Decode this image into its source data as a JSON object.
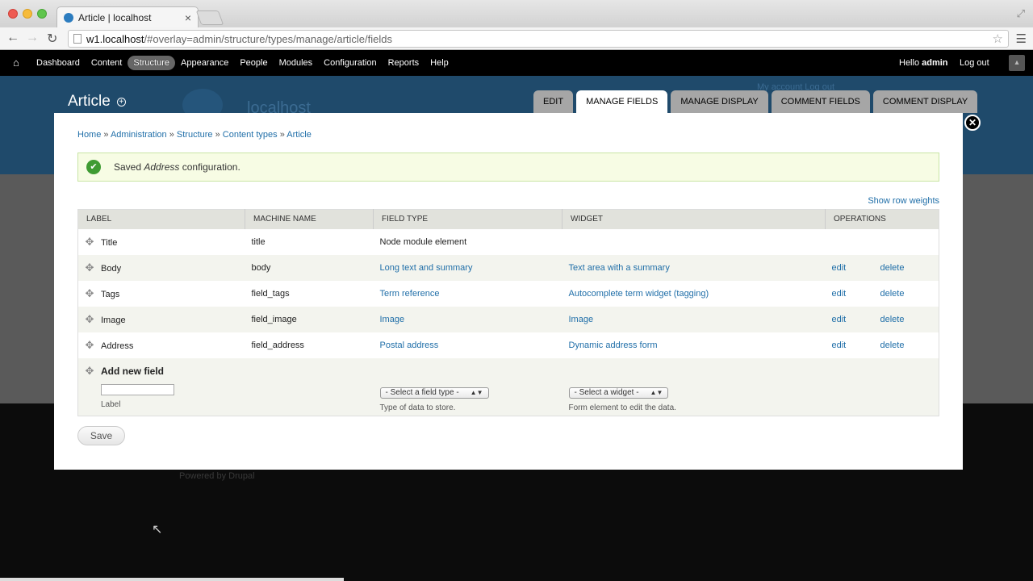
{
  "browser": {
    "tab_title": "Article | localhost",
    "url_host": "w1.localhost",
    "url_rest": "/#overlay=admin/structure/types/manage/article/fields"
  },
  "toolbar": {
    "items": [
      "Dashboard",
      "Content",
      "Structure",
      "Appearance",
      "People",
      "Modules",
      "Configuration",
      "Reports",
      "Help"
    ],
    "active": "Structure",
    "hello_prefix": "Hello ",
    "hello_user": "admin",
    "logout": "Log out"
  },
  "background": {
    "site_name": "localhost",
    "links": "My account   Log out",
    "powered": "Powered by Drupal"
  },
  "overlay": {
    "title": "Article",
    "tabs": [
      "EDIT",
      "MANAGE FIELDS",
      "MANAGE DISPLAY",
      "COMMENT FIELDS",
      "COMMENT DISPLAY"
    ],
    "active_tab": "MANAGE FIELDS"
  },
  "breadcrumb": [
    "Home",
    "Administration",
    "Structure",
    "Content types",
    "Article"
  ],
  "status": {
    "prefix": "Saved ",
    "item": "Address",
    "suffix": " configuration."
  },
  "row_weights": "Show row weights",
  "table": {
    "headers": [
      "LABEL",
      "MACHINE NAME",
      "FIELD TYPE",
      "WIDGET",
      "OPERATIONS"
    ],
    "rows": [
      {
        "label": "Title",
        "machine": "title",
        "type": "Node module element",
        "widget": "",
        "edit": "",
        "delete": ""
      },
      {
        "label": "Body",
        "machine": "body",
        "type": "Long text and summary",
        "widget": "Text area with a summary",
        "edit": "edit",
        "delete": "delete"
      },
      {
        "label": "Tags",
        "machine": "field_tags",
        "type": "Term reference",
        "widget": "Autocomplete term widget (tagging)",
        "edit": "edit",
        "delete": "delete"
      },
      {
        "label": "Image",
        "machine": "field_image",
        "type": "Image",
        "widget": "Image",
        "edit": "edit",
        "delete": "delete"
      },
      {
        "label": "Address",
        "machine": "field_address",
        "type": "Postal address",
        "widget": "Dynamic address form",
        "edit": "edit",
        "delete": "delete"
      }
    ],
    "add_new": {
      "title": "Add new field",
      "label_desc": "Label",
      "type_placeholder": "- Select a field type -",
      "type_desc": "Type of data to store.",
      "widget_placeholder": "- Select a widget -",
      "widget_desc": "Form element to edit the data."
    }
  },
  "save_label": "Save",
  "colors": {
    "link": "#1f6ea8",
    "header_bg": "#1f4a6b",
    "status_bg": "#f7fce4",
    "status_ok": "#3f9b33"
  }
}
